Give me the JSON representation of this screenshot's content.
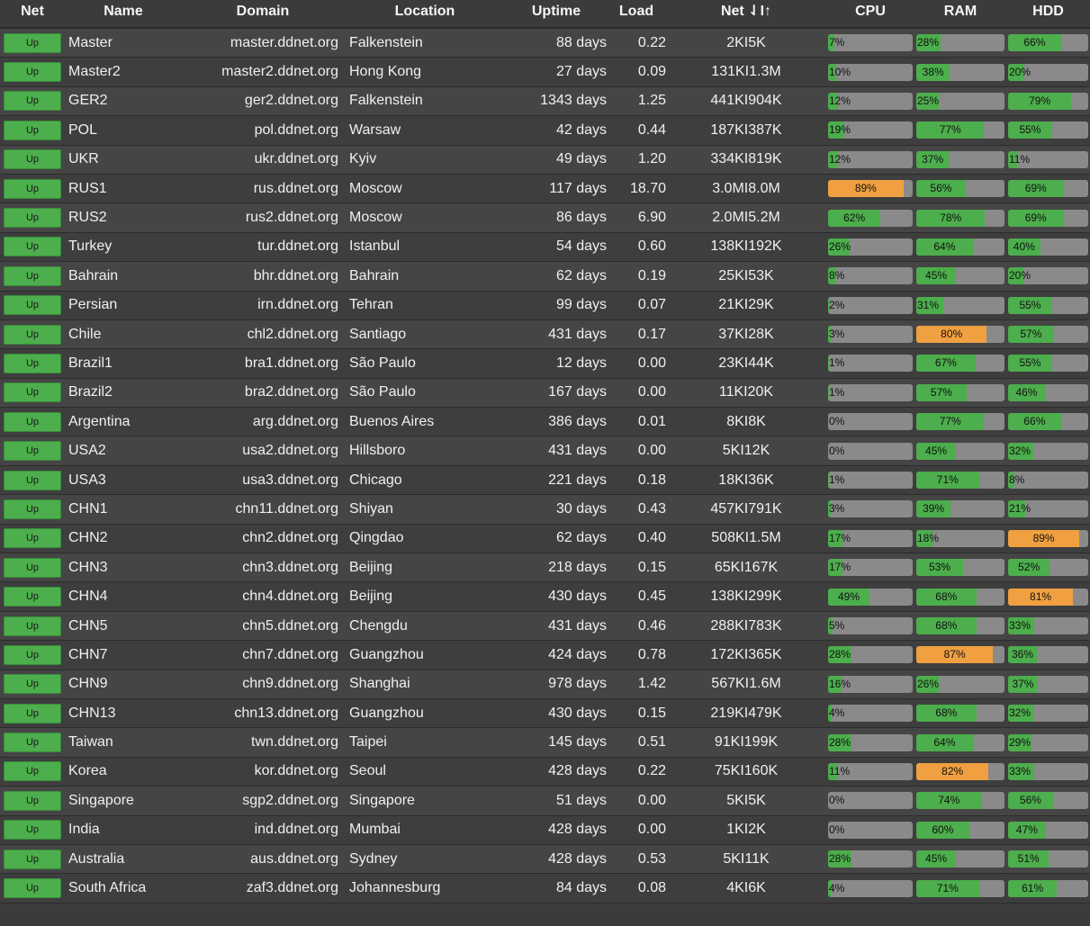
{
  "headers": {
    "net": "Net",
    "name": "Name",
    "domain": "Domain",
    "location": "Location",
    "uptime": "Uptime",
    "load": "Load",
    "netio": "Net ⇃I↑",
    "cpu": "CPU",
    "ram": "RAM",
    "hdd": "HDD"
  },
  "status_label": "Up",
  "colors": {
    "bar_ok": "#4cae4c",
    "bar_warn": "#f0a040",
    "bar_track": "#8a8a8a",
    "background": "#3b3b3b"
  },
  "rows": [
    {
      "name": "Master",
      "domain": "master.ddnet.org",
      "location": "Falkenstein",
      "uptime": "88 days",
      "load": "0.22",
      "netio": "2KI5K",
      "cpu": 7,
      "ram": 28,
      "hdd": 66
    },
    {
      "name": "Master2",
      "domain": "master2.ddnet.org",
      "location": "Hong Kong",
      "uptime": "27 days",
      "load": "0.09",
      "netio": "131KI1.3M",
      "cpu": 10,
      "ram": 38,
      "hdd": 20
    },
    {
      "name": "GER2",
      "domain": "ger2.ddnet.org",
      "location": "Falkenstein",
      "uptime": "1343 days",
      "load": "1.25",
      "netio": "441KI904K",
      "cpu": 12,
      "ram": 25,
      "hdd": 79
    },
    {
      "name": "POL",
      "domain": "pol.ddnet.org",
      "location": "Warsaw",
      "uptime": "42 days",
      "load": "0.44",
      "netio": "187KI387K",
      "cpu": 19,
      "ram": 77,
      "hdd": 55
    },
    {
      "name": "UKR",
      "domain": "ukr.ddnet.org",
      "location": "Kyiv",
      "uptime": "49 days",
      "load": "1.20",
      "netio": "334KI819K",
      "cpu": 12,
      "ram": 37,
      "hdd": 11
    },
    {
      "name": "RUS1",
      "domain": "rus.ddnet.org",
      "location": "Moscow",
      "uptime": "117 days",
      "load": "18.70",
      "netio": "3.0MI8.0M",
      "cpu": 89,
      "ram": 56,
      "hdd": 69
    },
    {
      "name": "RUS2",
      "domain": "rus2.ddnet.org",
      "location": "Moscow",
      "uptime": "86 days",
      "load": "6.90",
      "netio": "2.0MI5.2M",
      "cpu": 62,
      "ram": 78,
      "hdd": 69
    },
    {
      "name": "Turkey",
      "domain": "tur.ddnet.org",
      "location": "Istanbul",
      "uptime": "54 days",
      "load": "0.60",
      "netio": "138KI192K",
      "cpu": 26,
      "ram": 64,
      "hdd": 40
    },
    {
      "name": "Bahrain",
      "domain": "bhr.ddnet.org",
      "location": "Bahrain",
      "uptime": "62 days",
      "load": "0.19",
      "netio": "25KI53K",
      "cpu": 8,
      "ram": 45,
      "hdd": 20
    },
    {
      "name": "Persian",
      "domain": "irn.ddnet.org",
      "location": "Tehran",
      "uptime": "99 days",
      "load": "0.07",
      "netio": "21KI29K",
      "cpu": 2,
      "ram": 31,
      "hdd": 55
    },
    {
      "name": "Chile",
      "domain": "chl2.ddnet.org",
      "location": "Santiago",
      "uptime": "431 days",
      "load": "0.17",
      "netio": "37KI28K",
      "cpu": 3,
      "ram": 80,
      "hdd": 57
    },
    {
      "name": "Brazil1",
      "domain": "bra1.ddnet.org",
      "location": "São Paulo",
      "uptime": "12 days",
      "load": "0.00",
      "netio": "23KI44K",
      "cpu": 1,
      "ram": 67,
      "hdd": 55
    },
    {
      "name": "Brazil2",
      "domain": "bra2.ddnet.org",
      "location": "São Paulo",
      "uptime": "167 days",
      "load": "0.00",
      "netio": "11KI20K",
      "cpu": 1,
      "ram": 57,
      "hdd": 46
    },
    {
      "name": "Argentina",
      "domain": "arg.ddnet.org",
      "location": "Buenos Aires",
      "uptime": "386 days",
      "load": "0.01",
      "netio": "8KI8K",
      "cpu": 0,
      "ram": 77,
      "hdd": 66
    },
    {
      "name": "USA2",
      "domain": "usa2.ddnet.org",
      "location": "Hillsboro",
      "uptime": "431 days",
      "load": "0.00",
      "netio": "5KI12K",
      "cpu": 0,
      "ram": 45,
      "hdd": 32
    },
    {
      "name": "USA3",
      "domain": "usa3.ddnet.org",
      "location": "Chicago",
      "uptime": "221 days",
      "load": "0.18",
      "netio": "18KI36K",
      "cpu": 1,
      "ram": 71,
      "hdd": 8
    },
    {
      "name": "CHN1",
      "domain": "chn11.ddnet.org",
      "location": "Shiyan",
      "uptime": "30 days",
      "load": "0.43",
      "netio": "457KI791K",
      "cpu": 3,
      "ram": 39,
      "hdd": 21
    },
    {
      "name": "CHN2",
      "domain": "chn2.ddnet.org",
      "location": "Qingdao",
      "uptime": "62 days",
      "load": "0.40",
      "netio": "508KI1.5M",
      "cpu": 17,
      "ram": 18,
      "hdd": 89
    },
    {
      "name": "CHN3",
      "domain": "chn3.ddnet.org",
      "location": "Beijing",
      "uptime": "218 days",
      "load": "0.15",
      "netio": "65KI167K",
      "cpu": 17,
      "ram": 53,
      "hdd": 52
    },
    {
      "name": "CHN4",
      "domain": "chn4.ddnet.org",
      "location": "Beijing",
      "uptime": "430 days",
      "load": "0.45",
      "netio": "138KI299K",
      "cpu": 49,
      "ram": 68,
      "hdd": 81
    },
    {
      "name": "CHN5",
      "domain": "chn5.ddnet.org",
      "location": "Chengdu",
      "uptime": "431 days",
      "load": "0.46",
      "netio": "288KI783K",
      "cpu": 5,
      "ram": 68,
      "hdd": 33
    },
    {
      "name": "CHN7",
      "domain": "chn7.ddnet.org",
      "location": "Guangzhou",
      "uptime": "424 days",
      "load": "0.78",
      "netio": "172KI365K",
      "cpu": 28,
      "ram": 87,
      "hdd": 36
    },
    {
      "name": "CHN9",
      "domain": "chn9.ddnet.org",
      "location": "Shanghai",
      "uptime": "978 days",
      "load": "1.42",
      "netio": "567KI1.6M",
      "cpu": 16,
      "ram": 26,
      "hdd": 37
    },
    {
      "name": "CHN13",
      "domain": "chn13.ddnet.org",
      "location": "Guangzhou",
      "uptime": "430 days",
      "load": "0.15",
      "netio": "219KI479K",
      "cpu": 4,
      "ram": 68,
      "hdd": 32
    },
    {
      "name": "Taiwan",
      "domain": "twn.ddnet.org",
      "location": "Taipei",
      "uptime": "145 days",
      "load": "0.51",
      "netio": "91KI199K",
      "cpu": 28,
      "ram": 64,
      "hdd": 29
    },
    {
      "name": "Korea",
      "domain": "kor.ddnet.org",
      "location": "Seoul",
      "uptime": "428 days",
      "load": "0.22",
      "netio": "75KI160K",
      "cpu": 11,
      "ram": 82,
      "hdd": 33
    },
    {
      "name": "Singapore",
      "domain": "sgp2.ddnet.org",
      "location": "Singapore",
      "uptime": "51 days",
      "load": "0.00",
      "netio": "5KI5K",
      "cpu": 0,
      "ram": 74,
      "hdd": 56
    },
    {
      "name": "India",
      "domain": "ind.ddnet.org",
      "location": "Mumbai",
      "uptime": "428 days",
      "load": "0.00",
      "netio": "1KI2K",
      "cpu": 0,
      "ram": 60,
      "hdd": 47
    },
    {
      "name": "Australia",
      "domain": "aus.ddnet.org",
      "location": "Sydney",
      "uptime": "428 days",
      "load": "0.53",
      "netio": "5KI11K",
      "cpu": 28,
      "ram": 45,
      "hdd": 51
    },
    {
      "name": "South Africa",
      "domain": "zaf3.ddnet.org",
      "location": "Johannesburg",
      "uptime": "84 days",
      "load": "0.08",
      "netio": "4KI6K",
      "cpu": 4,
      "ram": 71,
      "hdd": 61
    }
  ]
}
